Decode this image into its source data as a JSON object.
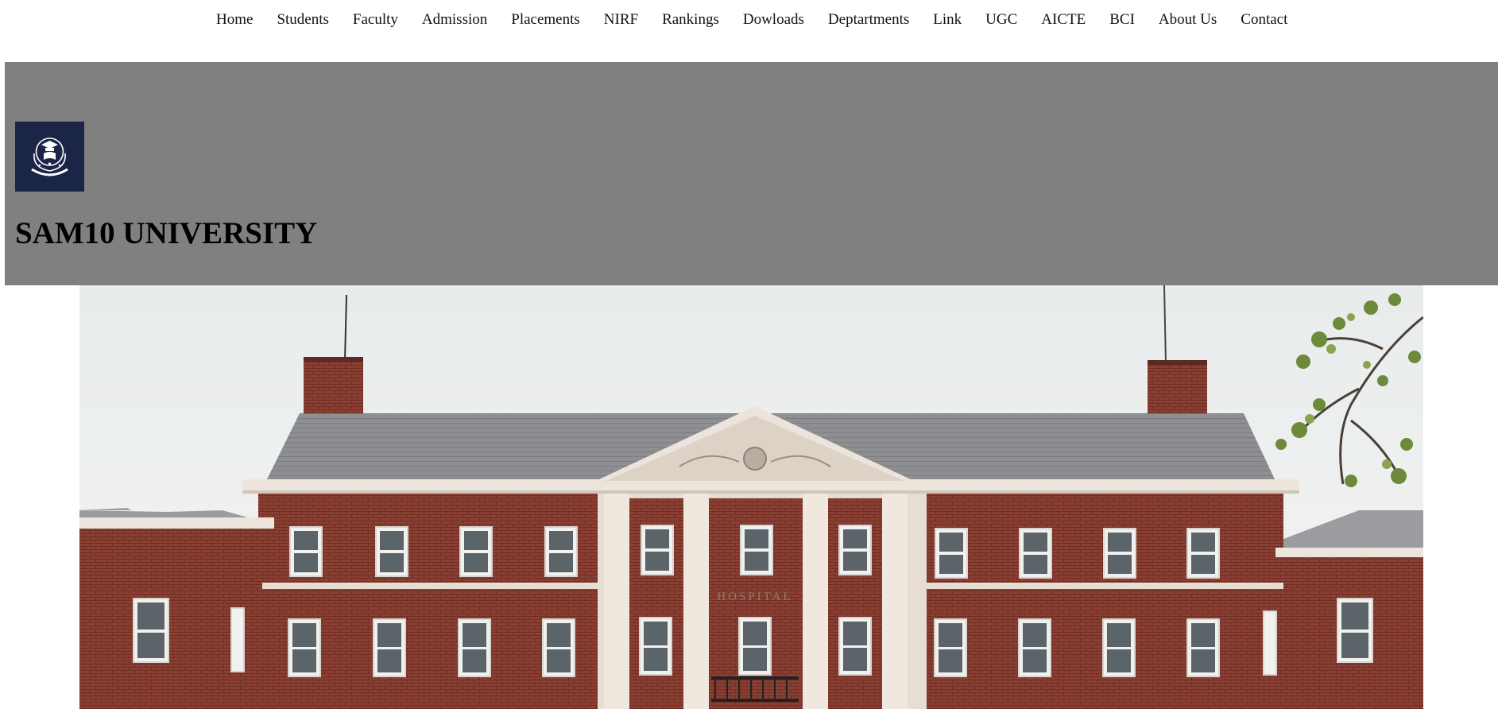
{
  "nav": {
    "items": [
      {
        "label": "Home"
      },
      {
        "label": "Students"
      },
      {
        "label": "Faculty"
      },
      {
        "label": "Admission"
      },
      {
        "label": "Placements"
      },
      {
        "label": "NIRF"
      },
      {
        "label": "Rankings"
      },
      {
        "label": "Dowloads"
      },
      {
        "label": "Deptartments"
      },
      {
        "label": "Link"
      },
      {
        "label": "UGC"
      },
      {
        "label": "AICTE"
      },
      {
        "label": "BCI"
      },
      {
        "label": "About Us"
      },
      {
        "label": "Contact"
      }
    ]
  },
  "header": {
    "title": "SAM10 UNIVERSITY",
    "logo_icon": "university-crest-icon",
    "background_color": "#808080",
    "logo_background_color": "#1b2547"
  },
  "hero": {
    "image": "university-building-photo",
    "building_sign": "HOSPITAL",
    "brick_color": "#8a3f32",
    "sky_color": "#eef0f0"
  }
}
